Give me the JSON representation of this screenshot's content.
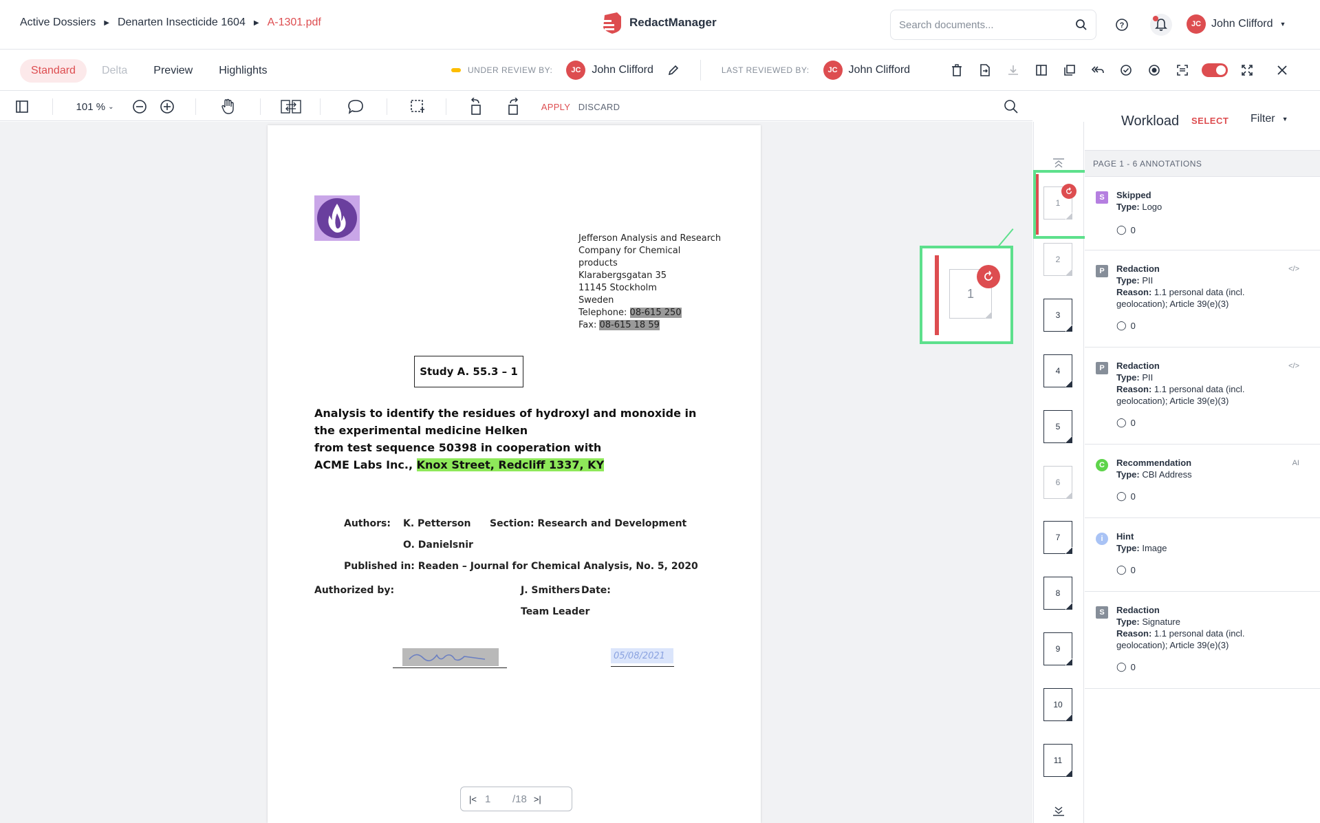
{
  "breadcrumb": {
    "items": [
      "Active Dossiers",
      "Denarten Insecticide 1604"
    ],
    "current": "A-1301.pdf"
  },
  "brand": {
    "name": "RedactManager",
    "color": "#dd4d50"
  },
  "search": {
    "placeholder": "Search documents..."
  },
  "user": {
    "initials": "JC",
    "name": "John Clifford"
  },
  "modes": [
    "Standard",
    "Delta",
    "Preview",
    "Highlights"
  ],
  "review": {
    "under_label": "UNDER REVIEW BY:",
    "under_name": "John Clifford",
    "last_label": "LAST REVIEWED BY:",
    "last_name": "John Clifford"
  },
  "viewer": {
    "zoom": "101 %",
    "apply": "APPLY",
    "discard": "DISCARD"
  },
  "document": {
    "address": [
      "Jefferson Analysis and Research",
      "Company for Chemical",
      "products",
      "Klarabergsgatan 35",
      "11145 Stockholm",
      "Sweden"
    ],
    "telephone_label": "Telephone:",
    "telephone": "08-615 250",
    "fax_label": "Fax:",
    "fax": "08-615 18 59",
    "study": "Study A. 55.3 – 1",
    "title_lines": [
      "Analysis to identify the residues of hydroxyl and monoxide in",
      "the experimental medicine Helken",
      "from test sequence 50398 in cooperation with"
    ],
    "title_last_prefix": "ACME Labs Inc., ",
    "title_last_highlight": "Knox Street, Redcliff 1337, KY",
    "authors_label": "Authors:",
    "author1": "K. Petterson",
    "section": "Section: Research and Development",
    "author2": "O. Danielsnir",
    "published": "Published in: Readen – Journal for Chemical Analysis, No. 5, 2020",
    "authorized_label": "Authorized by:",
    "signer": "J. Smithers",
    "date_label": "Date:",
    "date_value": "05/08/2021",
    "role": "Team Leader"
  },
  "pager": {
    "current": "1",
    "total": "/18"
  },
  "thumbnails": [
    "1",
    "2",
    "3",
    "4",
    "5",
    "6",
    "7",
    "8",
    "9",
    "10",
    "11"
  ],
  "callout_page": "1",
  "workload": {
    "title": "Workload",
    "select": "SELECT",
    "filter": "Filter",
    "page_header": "PAGE 1 - 6 ANNOTATIONS",
    "annotations": [
      {
        "icon": "S",
        "color": "#b57fe0",
        "title": "Skipped",
        "type_label": "Type:",
        "type": "Logo",
        "reason_label": "",
        "reason": "",
        "comments": "0",
        "tag": ""
      },
      {
        "icon": "P",
        "color": "#868e99",
        "title": "Redaction",
        "type_label": "Type:",
        "type": "PII",
        "reason_label": "Reason:",
        "reason": "1.1 personal data (incl. geolocation); Article 39(e)(3)",
        "comments": "0",
        "tag": "</>"
      },
      {
        "icon": "P",
        "color": "#868e99",
        "title": "Redaction",
        "type_label": "Type:",
        "type": "PII",
        "reason_label": "Reason:",
        "reason": "1.1 personal data (incl. geolocation); Article 39(e)(3)",
        "comments": "0",
        "tag": "</>"
      },
      {
        "icon": "C",
        "color": "#5ed44b",
        "title": "Recommendation",
        "type_label": "Type:",
        "type": "CBI Address",
        "reason_label": "",
        "reason": "",
        "comments": "0",
        "tag": "AI"
      },
      {
        "icon": "i",
        "color": "#a9c3f5",
        "title": "Hint",
        "type_label": "Type:",
        "type": "Image",
        "reason_label": "",
        "reason": "",
        "comments": "0",
        "tag": ""
      },
      {
        "icon": "S",
        "color": "#868e99",
        "title": "Redaction",
        "type_label": "Type:",
        "type": "Signature",
        "reason_label": "Reason:",
        "reason": "1.1 personal data (incl. geolocation); Article 39(e)(3)",
        "comments": "0",
        "tag": ""
      }
    ]
  }
}
